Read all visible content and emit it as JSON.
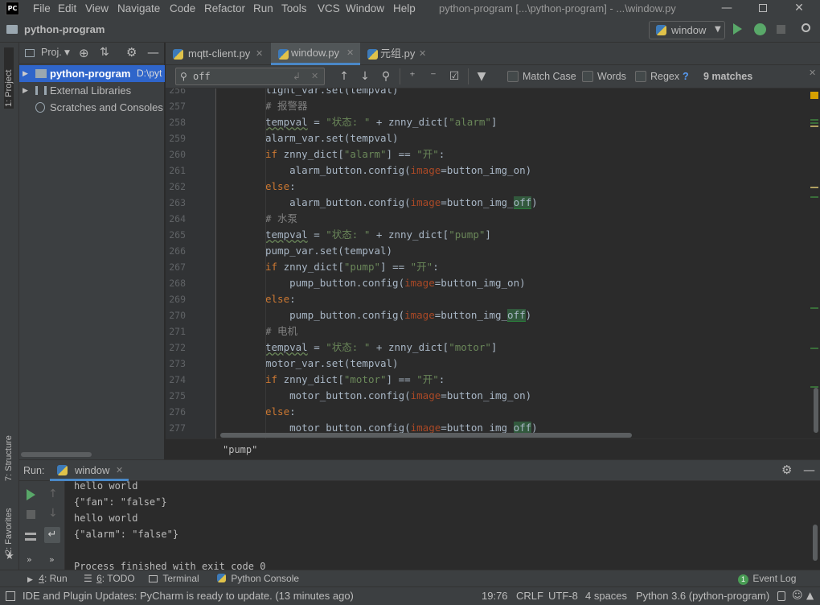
{
  "app": {
    "logo_text": "PC",
    "window_title": "python-program [...\\python-program] - ...\\window.py"
  },
  "menu": [
    "File",
    "Edit",
    "View",
    "Navigate",
    "Code",
    "Refactor",
    "Run",
    "Tools",
    "VCS",
    "Window",
    "Help"
  ],
  "navbar": {
    "project_name": "python-program",
    "run_config": "window"
  },
  "sidebar_left": {
    "project_tab": "1: Project",
    "structure_tab": "7: Structure",
    "favorites_tab": "2: Favorites"
  },
  "project_panel": {
    "selector": "Proj.",
    "items": [
      {
        "label": "python-program",
        "path": "D:\\pyt"
      },
      {
        "label": "External Libraries"
      },
      {
        "label": "Scratches and Consoles"
      }
    ]
  },
  "tabs": [
    {
      "label": "mqtt-client.py"
    },
    {
      "label": "window.py"
    },
    {
      "label": "元组.py"
    }
  ],
  "search": {
    "query": "off",
    "match_case": "Match Case",
    "words": "Words",
    "regex": "Regex",
    "regex_help": "?",
    "matches": "9 matches"
  },
  "editor": {
    "line_numbers": [
      "256",
      "257",
      "258",
      "259",
      "260",
      "261",
      "262",
      "263",
      "264",
      "265",
      "266",
      "267",
      "268",
      "269",
      "270",
      "271",
      "272",
      "273",
      "274",
      "275",
      "276",
      "277"
    ],
    "breadcrumb": "\"pump\""
  },
  "run_panel": {
    "label": "Run:",
    "tab": "window",
    "output": [
      "hello world",
      "{\"fan\": \"false\"}",
      "hello world",
      "{\"alarm\": \"false\"}",
      "",
      "Process finished with exit code 0"
    ]
  },
  "bottom_tools": {
    "run": {
      "num": "4",
      "label": ": Run"
    },
    "todo": {
      "num": "6",
      "label": ": TODO"
    },
    "terminal": "Terminal",
    "python_console": "Python Console",
    "event_log_badge": "1",
    "event_log": "Event Log"
  },
  "status": {
    "message": "IDE and Plugin Updates: PyCharm is ready to update. (13 minutes ago)",
    "position": "19:76",
    "line_sep": "CRLF",
    "encoding": "UTF-8",
    "indent": "4 spaces",
    "interpreter": "Python 3.6 (python-program)"
  }
}
